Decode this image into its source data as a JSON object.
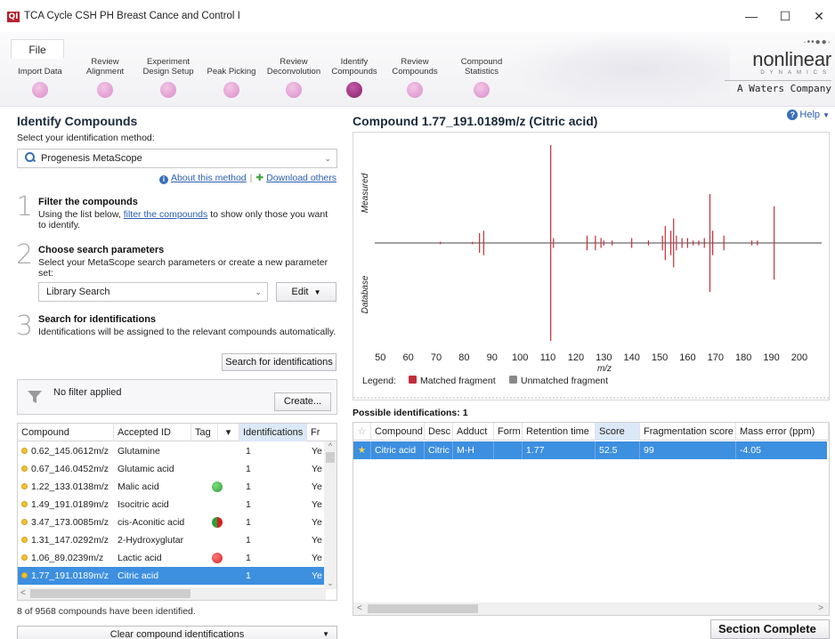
{
  "window": {
    "app_icon": "QI",
    "title": "TCA Cycle CSH PH Breast Cance and Control I",
    "minimize": "—",
    "maximize": "☐",
    "close": "✕"
  },
  "ribbon": {
    "file_label": "File",
    "steps": [
      {
        "label": "Import Data",
        "active": false
      },
      {
        "label": "Review Alignment",
        "active": false
      },
      {
        "label": "Experiment Design Setup",
        "active": false
      },
      {
        "label": "Peak Picking",
        "active": false
      },
      {
        "label": "Review Deconvolution",
        "active": false
      },
      {
        "label": "Identify Compounds",
        "active": true
      },
      {
        "label": "Review Compounds",
        "active": false
      },
      {
        "label": "Compound Statistics",
        "active": false
      }
    ],
    "brand": {
      "dots": "·••●●·",
      "name": "nonlinear",
      "sub": "DYNAMICS",
      "company": "A Waters Company"
    }
  },
  "left": {
    "title": "Identify Compounds",
    "method_prompt": "Select your identification method:",
    "method_value": "Progenesis MetaScope",
    "about_link": "About this method",
    "download_link": "Download others",
    "step1": {
      "num": "1",
      "title": "Filter the compounds",
      "desc_a": "Using the list below, ",
      "desc_link": "filter the compounds",
      "desc_b": " to show only those you want to identify."
    },
    "step2": {
      "num": "2",
      "title": "Choose search parameters",
      "desc": "Select your MetaScope search parameters or create a new parameter set:",
      "param_value": "Library Search",
      "edit_label": "Edit"
    },
    "step3": {
      "num": "3",
      "title": "Search for identifications",
      "desc": "Identifications will be assigned to the relevant compounds automatically.",
      "search_label": "Search for identifications"
    },
    "filter": {
      "text": "No filter applied",
      "create_label": "Create..."
    },
    "table": {
      "headers": [
        "Compound",
        "Accepted ID",
        "Tag",
        "▾",
        "Identifications",
        "Fr"
      ],
      "rows": [
        {
          "compound": "0.62_145.0612m/z",
          "id": "Glutamine",
          "tag": "",
          "ident": "1",
          "fr": "Ye"
        },
        {
          "compound": "0.67_146.0452m/z",
          "id": "Glutamic acid",
          "tag": "",
          "ident": "1",
          "fr": "Ye"
        },
        {
          "compound": "1.22_133.0138m/z",
          "id": "Malic acid",
          "tag": "green",
          "ident": "1",
          "fr": "Ye"
        },
        {
          "compound": "1.49_191.0189m/z",
          "id": "Isocitric acid",
          "tag": "",
          "ident": "1",
          "fr": "Ye"
        },
        {
          "compound": "3.47_173.0085m/z",
          "id": "cis-Aconitic acid",
          "tag": "mixed",
          "ident": "1",
          "fr": "Ye"
        },
        {
          "compound": "1.31_147.0292m/z",
          "id": "2-Hydroxyglutar",
          "tag": "",
          "ident": "1",
          "fr": "Ye"
        },
        {
          "compound": "1.06_89.0239m/z",
          "id": "Lactic acid",
          "tag": "red",
          "ident": "1",
          "fr": "Ye"
        },
        {
          "compound": "1.77_191.0189m/z",
          "id": "Citric acid",
          "tag": "",
          "ident": "1",
          "fr": "Ye",
          "selected": true
        }
      ],
      "scroll_up": "^",
      "scroll_down": "⌄",
      "scroll_left": "<"
    },
    "count_text": "8 of 9568 compounds have been identified.",
    "clear_label": "Clear compound identifications"
  },
  "right": {
    "chart_title": "Compound 1.77_191.0189m/z (Citric acid)",
    "help_label": "Help",
    "legend_label": "Legend:",
    "legend_matched": "Matched fragment",
    "legend_unmatched": "Unmatched fragment",
    "measured_label": "Measured",
    "database_label": "Database",
    "xlabel": "m/z",
    "possible_title": "Possible identifications: 1",
    "table": {
      "headers": [
        "☆",
        "Compound",
        "Desc",
        "Adduct",
        "Form",
        "Retention time",
        "Score",
        "Fragmentation score",
        "Mass error (ppm)"
      ],
      "row": {
        "star": "★",
        "compound": "Citric acid",
        "desc": "Citric",
        "adduct": "M-H",
        "form": "",
        "rt": "1.77",
        "score": "52.5",
        "frag": "99",
        "mass_error": "-4.05"
      },
      "scroll_left": "<",
      "scroll_right": ">"
    },
    "section_complete": "Section Complete"
  },
  "colors": {
    "accent": "#3d8fe0",
    "matched": "#c0303c",
    "unmatched": "#8a8a8a",
    "active_step": "#8a1f6d",
    "step": "#e0a0d2"
  },
  "chart_data": {
    "type": "bar",
    "title": "Compound 1.77_191.0189m/z (Citric acid)",
    "xlabel": "m/z",
    "ylabel_top": "Measured",
    "ylabel_bottom": "Database",
    "xlim": [
      48,
      208
    ],
    "xticks": [
      50,
      60,
      70,
      80,
      90,
      100,
      110,
      120,
      130,
      140,
      150,
      160,
      170,
      180,
      190,
      200
    ],
    "grid": false,
    "legend": "bottom",
    "series": [
      {
        "name": "Measured",
        "x": [
          71.5,
          83,
          85.5,
          87,
          111,
          112,
          124,
          127,
          129,
          130,
          133,
          140,
          146,
          151,
          152,
          154,
          155,
          156,
          158,
          160,
          162,
          164,
          166,
          168,
          169,
          173,
          183,
          185,
          191
        ],
        "y": [
          0.5,
          0.5,
          4,
          5,
          40,
          2,
          3,
          3,
          2,
          1,
          1,
          2,
          1,
          3,
          7,
          5,
          10,
          3,
          2,
          2,
          1,
          1,
          2,
          20,
          5,
          3,
          1,
          1,
          15
        ]
      },
      {
        "name": "Database",
        "x": [
          71.5,
          83,
          85.5,
          87,
          111,
          112,
          124,
          127,
          129,
          130,
          133,
          140,
          146,
          151,
          152,
          154,
          155,
          156,
          158,
          160,
          162,
          164,
          166,
          168,
          169,
          173,
          183,
          185,
          191
        ],
        "y": [
          0.5,
          0.5,
          4,
          5,
          40,
          2,
          3,
          3,
          2,
          1,
          1,
          2,
          1,
          3,
          7,
          5,
          10,
          3,
          2,
          2,
          1,
          1,
          2,
          20,
          5,
          3,
          1,
          1,
          15
        ]
      }
    ],
    "ylim": [
      0,
      40
    ]
  }
}
